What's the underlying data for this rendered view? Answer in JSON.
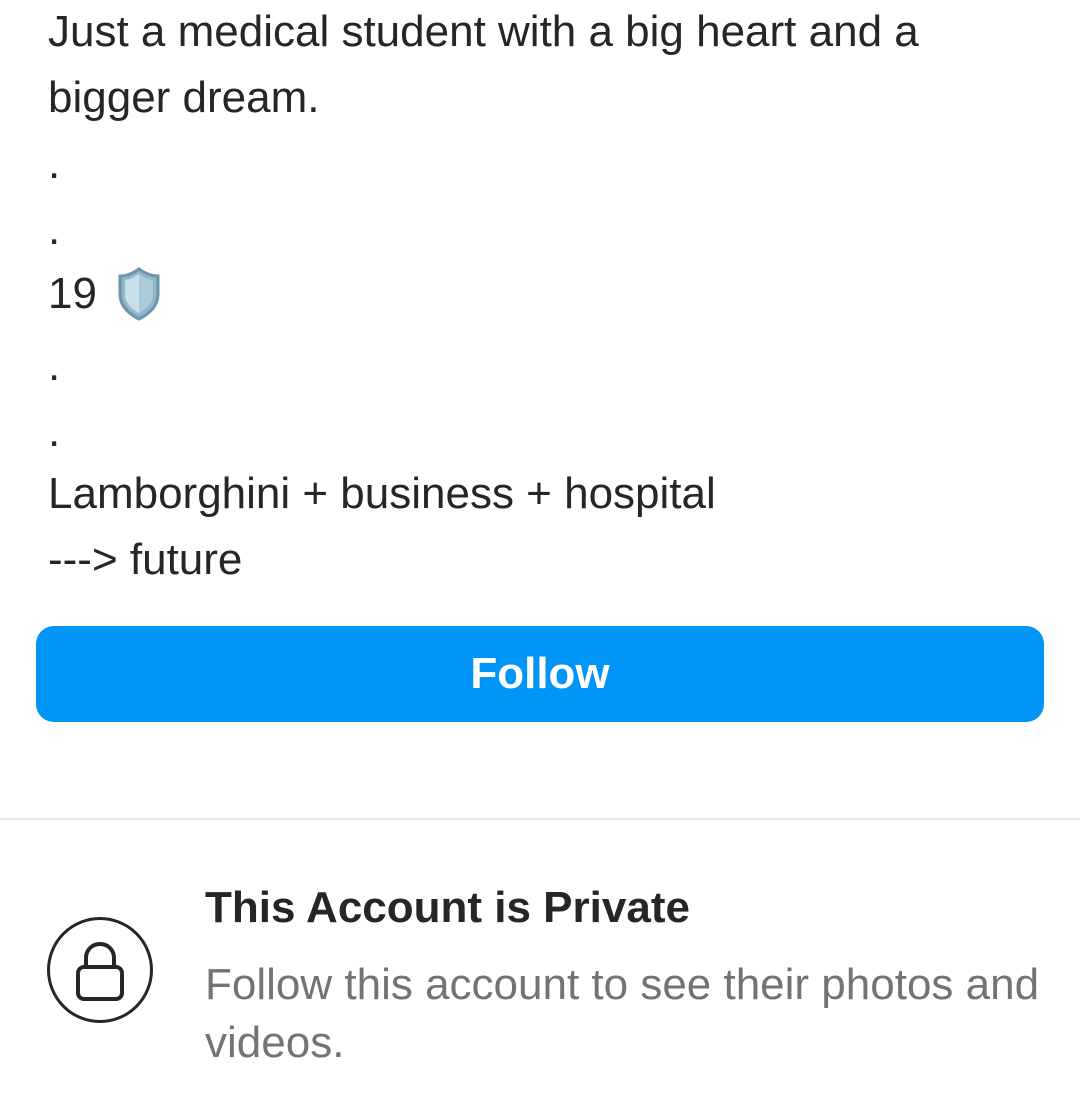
{
  "bio": {
    "line1": "Just a medical student with a big heart and a",
    "line2": "bigger dream.",
    "dot1": ".",
    "dot2": ".",
    "age": "19",
    "age_icon": "shield-icon",
    "dot3": ".",
    "dot4": ".",
    "line_lambo": "Lamborghini + business + hospital",
    "line_future": "---> future"
  },
  "follow_button": {
    "label": "Follow",
    "color": "#0095f6"
  },
  "private_notice": {
    "icon": "lock-icon",
    "title": "This Account is Private",
    "subtitle": "Follow this account to see their photos and videos."
  }
}
